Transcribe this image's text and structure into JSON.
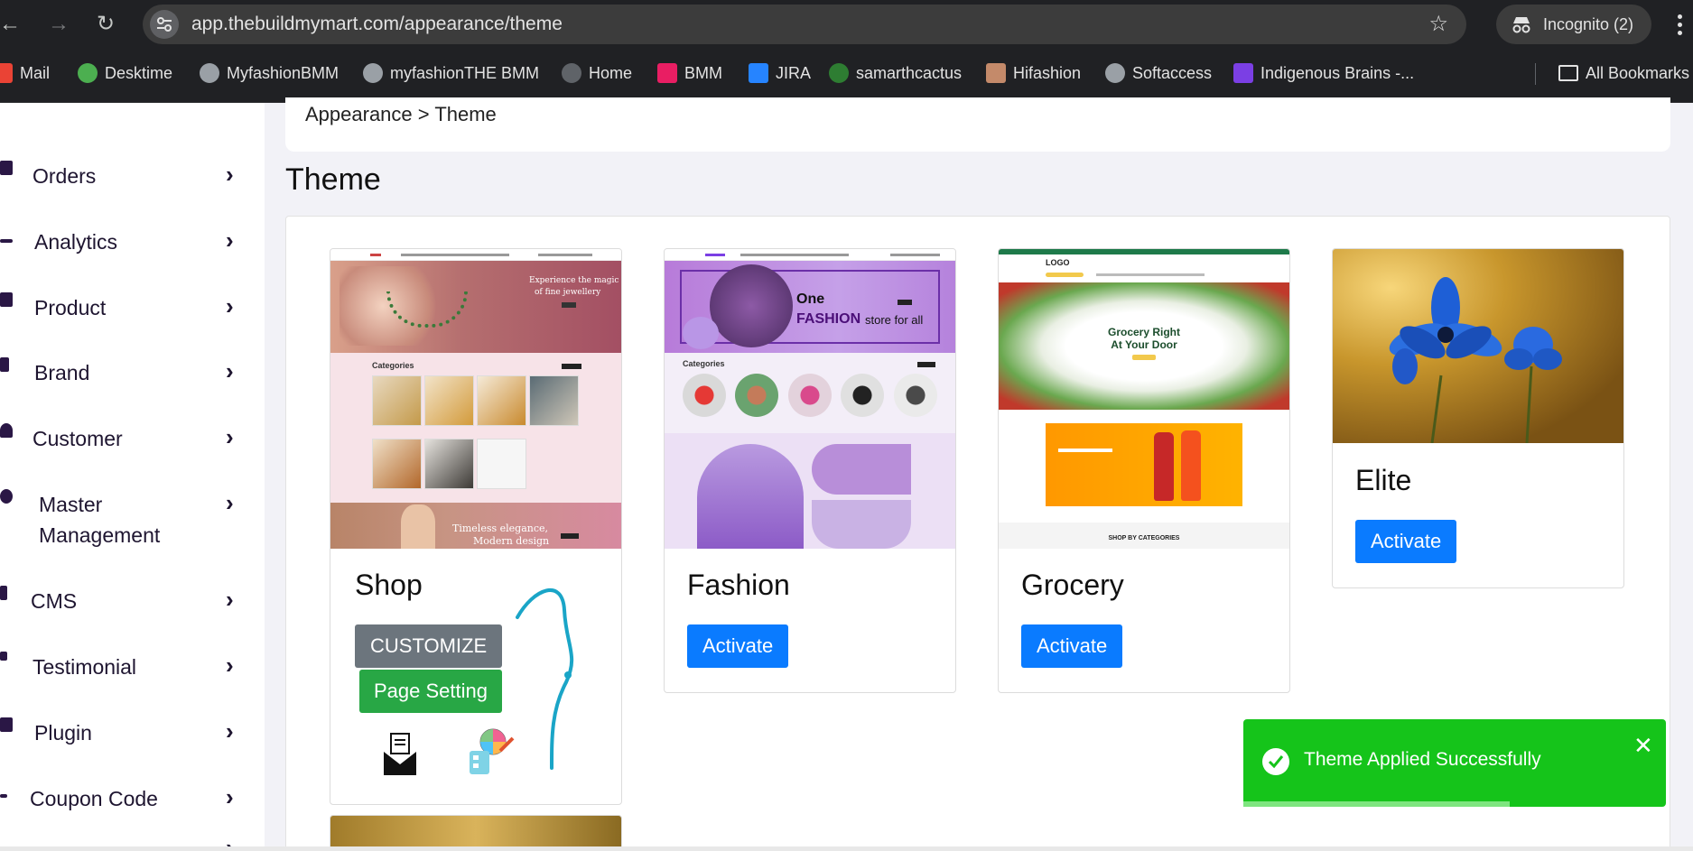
{
  "browser": {
    "url": "app.thebuildmymart.com/appearance/theme",
    "incognito_label": "Incognito (2)",
    "bookmarks": [
      {
        "label": "Mail",
        "color": "#ea4335"
      },
      {
        "label": "Desktime",
        "color": "#4caf50"
      },
      {
        "label": "MyfashionBMM",
        "color": "#9aa0a6"
      },
      {
        "label": "myfashionTHE BMM",
        "color": "#9aa0a6"
      },
      {
        "label": "Home",
        "color": "#5f6368"
      },
      {
        "label": "BMM",
        "color": "#e91e63"
      },
      {
        "label": "JIRA",
        "color": "#2684ff"
      },
      {
        "label": "samarthcactus",
        "color": "#2e7d32"
      },
      {
        "label": "Hifashion",
        "color": "#c48a6a"
      },
      {
        "label": "Softaccess",
        "color": "#9aa0a6"
      },
      {
        "label": "Indigenous Brains -...",
        "color": "#7b3fe4"
      }
    ],
    "all_bookmarks_label": "All Bookmarks"
  },
  "sidebar": {
    "items": [
      {
        "label": "Orders"
      },
      {
        "label": "Analytics"
      },
      {
        "label": "Product"
      },
      {
        "label": "Brand"
      },
      {
        "label": "Customer"
      },
      {
        "label": "Master",
        "label2": "Management"
      },
      {
        "label": "CMS"
      },
      {
        "label": "Testimonial"
      },
      {
        "label": "Plugin"
      },
      {
        "label": "Coupon Code"
      }
    ]
  },
  "main": {
    "breadcrumb": "Appearance > Theme",
    "title": "Theme",
    "themes": [
      {
        "name": "Shop",
        "customize_label": "CUSTOMIZE",
        "page_setting_label": "Page Setting",
        "banner_text1": "Experience the magic",
        "banner_text2": "of fine jewellery",
        "categories_label": "Categories",
        "footer_text1": "Timeless elegance,",
        "footer_text2": "Modern design"
      },
      {
        "name": "Fashion",
        "activate_label": "Activate",
        "banner_text1": "One",
        "banner_text2": "FASHION",
        "banner_text3": "store for all",
        "categories_label": "Categories"
      },
      {
        "name": "Grocery",
        "activate_label": "Activate",
        "logo_text": "LOGO",
        "hero_text1": "Grocery Right",
        "hero_text2": "At Your Door",
        "shop_by_text": "SHOP BY CATEGORIES"
      },
      {
        "name": "Elite",
        "activate_label": "Activate"
      }
    ]
  },
  "toast": {
    "message": "Theme Applied Successfully",
    "progress_fraction": 0.63,
    "color": "#15c41a"
  },
  "colors": {
    "primary": "#0a7bff",
    "success": "#28a745",
    "secondary": "#6c757d"
  }
}
